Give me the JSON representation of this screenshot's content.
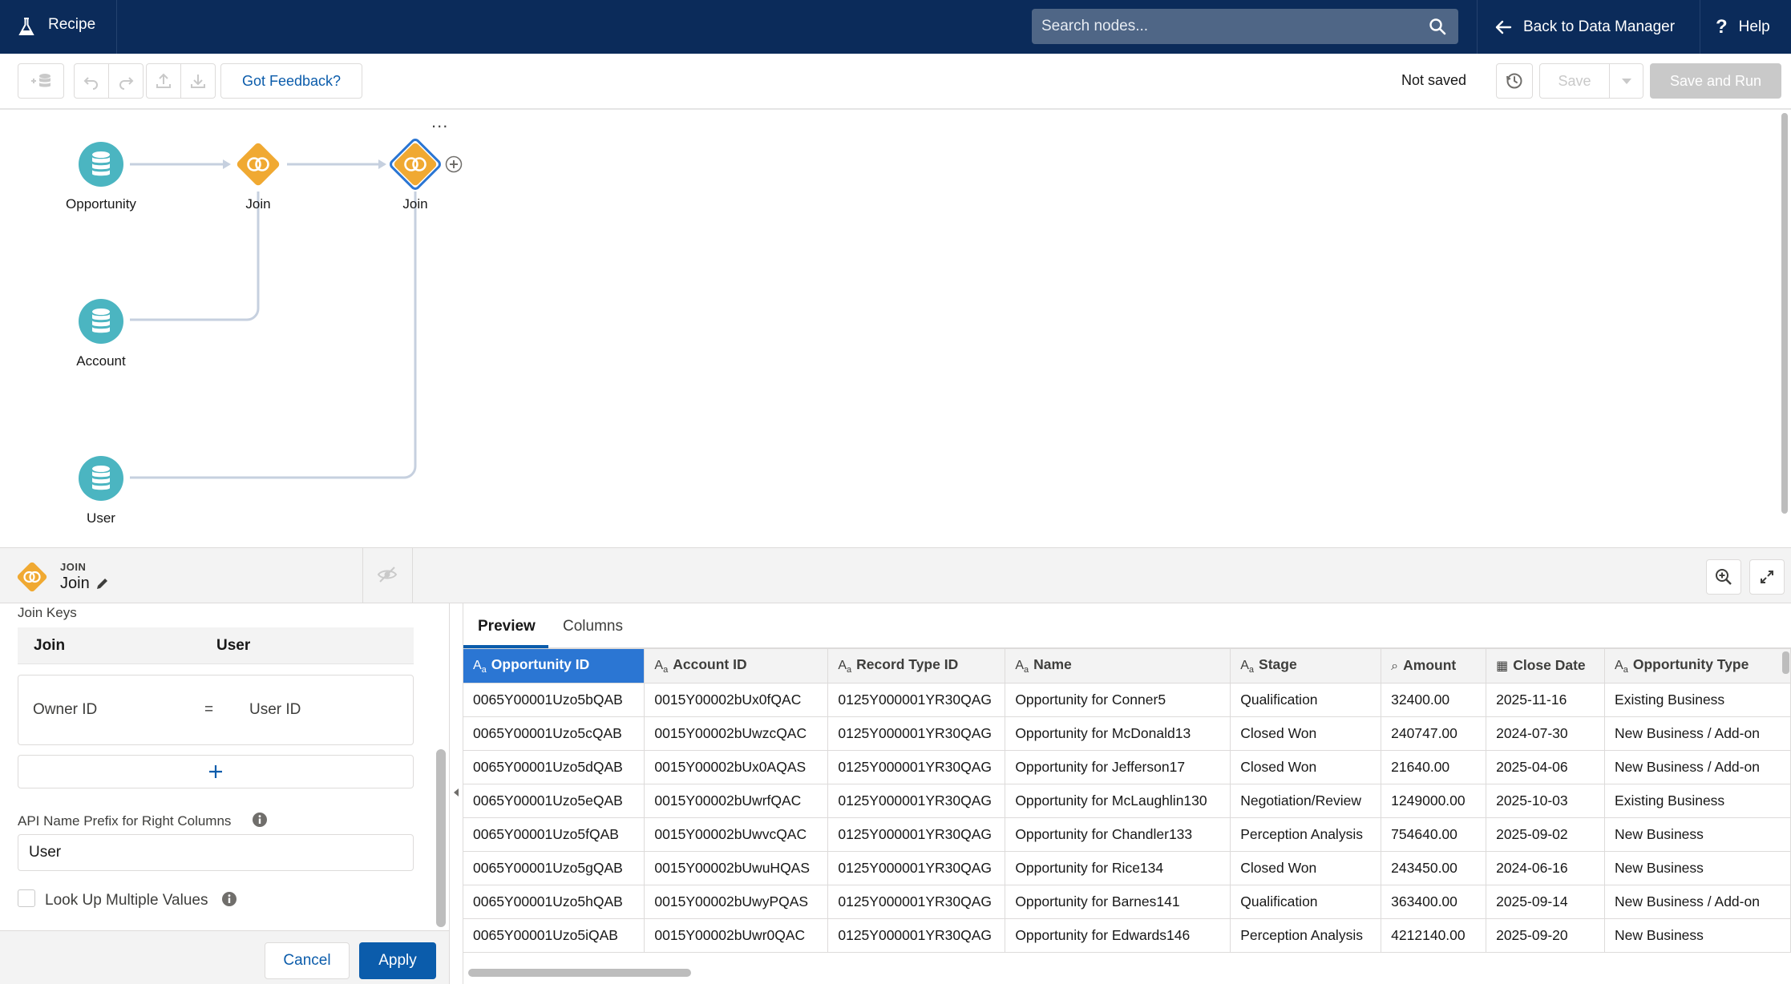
{
  "app": {
    "title": "Recipe"
  },
  "header": {
    "search_placeholder": "Search nodes...",
    "back_label": "Back to Data Manager",
    "help_label": "Help"
  },
  "toolbar": {
    "feedback_label": "Got Feedback?",
    "status": "Not saved",
    "save_label": "Save",
    "save_run_label": "Save and Run"
  },
  "canvas": {
    "more": "...",
    "nodes": [
      {
        "label": "Opportunity",
        "type": "input"
      },
      {
        "label": "Join",
        "type": "join"
      },
      {
        "label": "Join",
        "type": "join",
        "selected": true
      },
      {
        "label": "Account",
        "type": "input"
      },
      {
        "label": "User",
        "type": "input"
      }
    ]
  },
  "panel": {
    "node_type": "JOIN",
    "node_name": "Join"
  },
  "config": {
    "join_keys_label": "Join Keys",
    "left_header": "Join",
    "right_header": "User",
    "key_left": "Owner ID",
    "key_op": "=",
    "key_right": "User ID",
    "prefix_label": "API Name Prefix for Right Columns",
    "prefix_value": "User",
    "lookup_label": "Look Up Multiple Values",
    "lookup_checked": false,
    "cancel_label": "Cancel",
    "apply_label": "Apply"
  },
  "preview": {
    "tabs": [
      "Preview",
      "Columns"
    ],
    "active_tab": 0,
    "columns": [
      {
        "label": "Opportunity ID",
        "type": "text",
        "selected": true
      },
      {
        "label": "Account ID",
        "type": "text"
      },
      {
        "label": "Record Type ID",
        "type": "text"
      },
      {
        "label": "Name",
        "type": "text"
      },
      {
        "label": "Stage",
        "type": "text"
      },
      {
        "label": "Amount",
        "type": "number"
      },
      {
        "label": "Close Date",
        "type": "date"
      },
      {
        "label": "Opportunity Type",
        "type": "text"
      }
    ],
    "rows": [
      [
        "0065Y00001Uzo5bQAB",
        "0015Y00002bUx0fQAC",
        "0125Y000001YR30QAG",
        "Opportunity for Conner5",
        "Qualification",
        "32400.00",
        "2025-11-16",
        "Existing Business"
      ],
      [
        "0065Y00001Uzo5cQAB",
        "0015Y00002bUwzcQAC",
        "0125Y000001YR30QAG",
        "Opportunity for McDonald13",
        "Closed Won",
        "240747.00",
        "2024-07-30",
        "New Business / Add-on"
      ],
      [
        "0065Y00001Uzo5dQAB",
        "0015Y00002bUx0AQAS",
        "0125Y000001YR30QAG",
        "Opportunity for Jefferson17",
        "Closed Won",
        "21640.00",
        "2025-04-06",
        "New Business / Add-on"
      ],
      [
        "0065Y00001Uzo5eQAB",
        "0015Y00002bUwrfQAC",
        "0125Y000001YR30QAG",
        "Opportunity for McLaughlin130",
        "Negotiation/Review",
        "1249000.00",
        "2025-10-03",
        "Existing Business"
      ],
      [
        "0065Y00001Uzo5fQAB",
        "0015Y00002bUwvcQAC",
        "0125Y000001YR30QAG",
        "Opportunity for Chandler133",
        "Perception Analysis",
        "754640.00",
        "2025-09-02",
        "New Business"
      ],
      [
        "0065Y00001Uzo5gQAB",
        "0015Y00002bUwuHQAS",
        "0125Y000001YR30QAG",
        "Opportunity for Rice134",
        "Closed Won",
        "243450.00",
        "2024-06-16",
        "New Business"
      ],
      [
        "0065Y00001Uzo5hQAB",
        "0015Y00002bUwyPQAS",
        "0125Y000001YR30QAG",
        "Opportunity for Barnes141",
        "Qualification",
        "363400.00",
        "2025-09-14",
        "New Business / Add-on"
      ],
      [
        "0065Y00001Uzo5iQAB",
        "0015Y00002bUwr0QAC",
        "0125Y000001YR30QAG",
        "Opportunity for Edwards146",
        "Perception Analysis",
        "4212140.00",
        "2025-09-20",
        "New Business"
      ]
    ]
  },
  "colors": {
    "nav_bg": "#0b2b5a",
    "brand_blue": "#0b5cab",
    "input_node": "#4bb5c1",
    "join_node": "#f0a932",
    "selected_header": "#2b76d3"
  }
}
